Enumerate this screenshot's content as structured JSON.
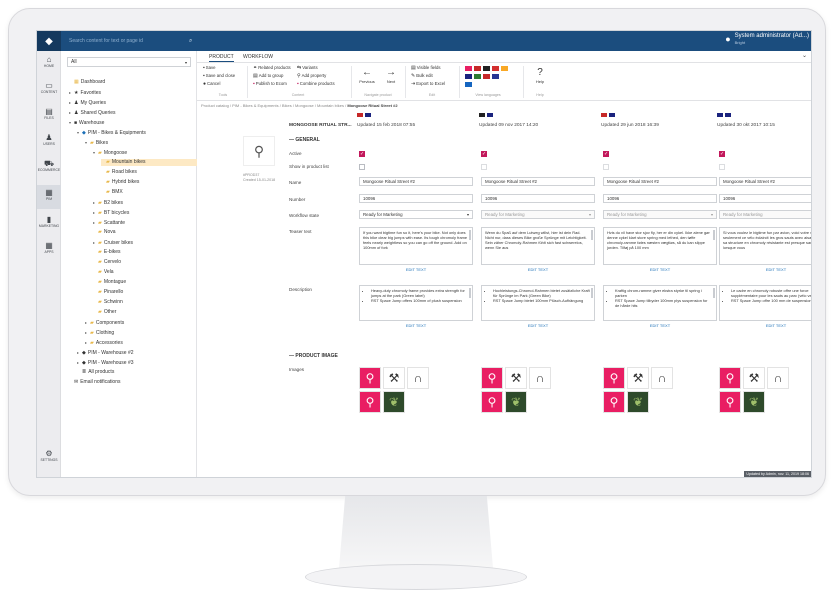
{
  "topbar": {
    "search_placeholder": "Search content for text or page id",
    "user_name": "System administrator (Ad...)",
    "user_sub": "Bright"
  },
  "rail": [
    {
      "icon": "home-icon",
      "glyph": "⌂",
      "label": "HOME"
    },
    {
      "icon": "monitor-icon",
      "glyph": "▭",
      "label": "CONTENT"
    },
    {
      "icon": "files-icon",
      "glyph": "▤",
      "label": "FILES"
    },
    {
      "icon": "user-icon",
      "glyph": "♟",
      "label": "USERS"
    },
    {
      "icon": "cart-icon",
      "glyph": "⛟",
      "label": "ECOMMERCE"
    },
    {
      "icon": "pim-icon",
      "glyph": "▦",
      "label": "PIM"
    },
    {
      "icon": "chart-icon",
      "glyph": "▮",
      "label": "MARKETING"
    },
    {
      "icon": "apps-icon",
      "glyph": "▦",
      "label": "APPS"
    },
    {
      "icon": "gear-icon",
      "glyph": "⚙",
      "label": "SETTINGS"
    }
  ],
  "tree": {
    "filter_value": "All",
    "nodes": [
      "Dashboard",
      "Favorites",
      "My Queries",
      "Shared Queries",
      "Warehouse",
      "PIM - Bikes & Equipments",
      "Bikes",
      "Mongoose",
      "Mountain bikes",
      "Road bikes",
      "Hybrid bikes",
      "BMX",
      "B2 bikes",
      "BT bicycles",
      "Scattante",
      "Nova",
      "Cruiser bikes",
      "E-bikes",
      "Cervelo",
      "Vela",
      "Montague",
      "Pinarello",
      "Schwinn",
      "Other",
      "Components",
      "Clothing",
      "Accessories",
      "PIM - Warehouse #2",
      "PIM - Warehouse #3",
      "All products",
      "Email notifications"
    ]
  },
  "tabs": [
    "PRODUCT",
    "WORKFLOW"
  ],
  "ribbon": {
    "save": "Save",
    "save_close": "Save and close",
    "cancel": "Cancel",
    "related": "Related products",
    "variants": "Variants",
    "add_group": "Add to group",
    "add_property": "Add property",
    "publish": "Publish to Ecom",
    "combine": "Combine products",
    "previous": "Previous",
    "next": "Next",
    "visible_fields": "Visible fields",
    "bulk_edit": "Bulk edit",
    "export_excel": "Export to Excel",
    "help": "Help",
    "groups": [
      "Tools",
      "Content",
      "Navigate product",
      "Edit",
      "View languages",
      "Help"
    ]
  },
  "breadcrumb": {
    "path": "Product catalog / PIM - Bikes & Equipments / Bikes / Mongoose / Mountain bikes /",
    "current": "Mongoose Ritual Street #2"
  },
  "columns": [
    {
      "lang": "English",
      "title": "MONGOOSE RITUAL STR...",
      "updated": "Updated 15 feb 2018 07:55",
      "name": "Mongoose Ritual Street #2",
      "number": "10096",
      "workflow": "Ready for Marketing",
      "workflow_disabled": false,
      "teaser": "If you want bigtime fun so it, here's your bike. Not only does this bike clear big jumps with ease. Its tough chromoly frame feels nearly weightless so you can go off the ground. Add on 100mm of fork",
      "desc": [
        "Heavy-duty chromoly frame provides extra strength for jumps at the park (Green label)",
        "RST Space Jump offers 100mm of plush suspension"
      ],
      "flags": [
        "#c62828",
        "#1a237e"
      ]
    },
    {
      "lang": "German",
      "title": "",
      "updated": "Updated 09 nov 2017 14:20",
      "name": "Mongoose Ritual Street #2",
      "number": "10096",
      "workflow": "Ready for Marketing",
      "workflow_disabled": true,
      "teaser": "Wenn du Spaß auf dem Lutweg willst, hier ist dein Rad. Nicht nur, dass dieses Bike große Sprünge mit Leichtigkeit. Sein zäher Chromoly-Rahmen fühlt sich fast schwerelos, wenn Sie aus",
      "desc": [
        "Hochleistungs-Chromol-Rahmen bietet zusätzliche Kraft für Sprünge im Park (Green Bike)",
        "RST Space Jump bietet 100mm Plüsch-Aufhängung"
      ],
      "flags": [
        "#212121",
        "#1a237e"
      ]
    },
    {
      "lang": "Danish",
      "title": "",
      "updated": "Updated 29 jun 2018 16:39",
      "name": "Mongoose Ritual Street #2",
      "number": "10096",
      "workflow": "Ready for Marketing",
      "workflow_disabled": true,
      "teaser": "Hvis du vil have stor sjov fly, her er din cykel. Ikke alene gør denne cykel klart store spring med lethed, den tøffe chromoly-ramme føles næsten vægtløs, så du kan slippe jorden. Tilføj på 100 mm",
      "desc": [
        "Kraftig chrom-ramme giver ekstra styrke til spring i parken",
        "RST Space Jump tilbyder 100mm plys suspension for de hårde hits"
      ],
      "flags": [
        "#c62828",
        "#1a237e"
      ]
    },
    {
      "lang": "French",
      "title": "",
      "updated": "Updated 30 okt 2017 10:15",
      "name": "Mongoose Ritual Street #2",
      "number": "10096",
      "workflow": "Ready for Marketing",
      "workflow_disabled": true,
      "teaser": "Si vous voulez le bigtime fun par avion, voici votre vélo. Non seulement ce vélo éclaircit les gros sauts avec aisance, mais sa structure en chromoly résistante est presque sans poids lorsque vous",
      "desc": [
        "Le cadre en chromoly robuste offre une force supplémentaire pour les sauts au parc (vélo vert)",
        "RST Space Jump offre 100 mm de suspension"
      ],
      "flags": [
        "#1a237e",
        "#1a237e"
      ]
    }
  ],
  "labels": {
    "general": "GENERAL",
    "active": "Active",
    "show_in_list": "Show in product list",
    "name": "Name",
    "number": "Number",
    "workflow_state": "Workflow state",
    "teaser": "Teaser text",
    "description": "Description",
    "edit_text": "EDIT TEXT",
    "product_image": "PRODUCT IMAGE",
    "images": "Images"
  },
  "product_meta": {
    "id": "#PROD37",
    "created": "Created 15-01-2018"
  },
  "tooltip": "Updated by Admin, nov. 11, 2019 18:06"
}
